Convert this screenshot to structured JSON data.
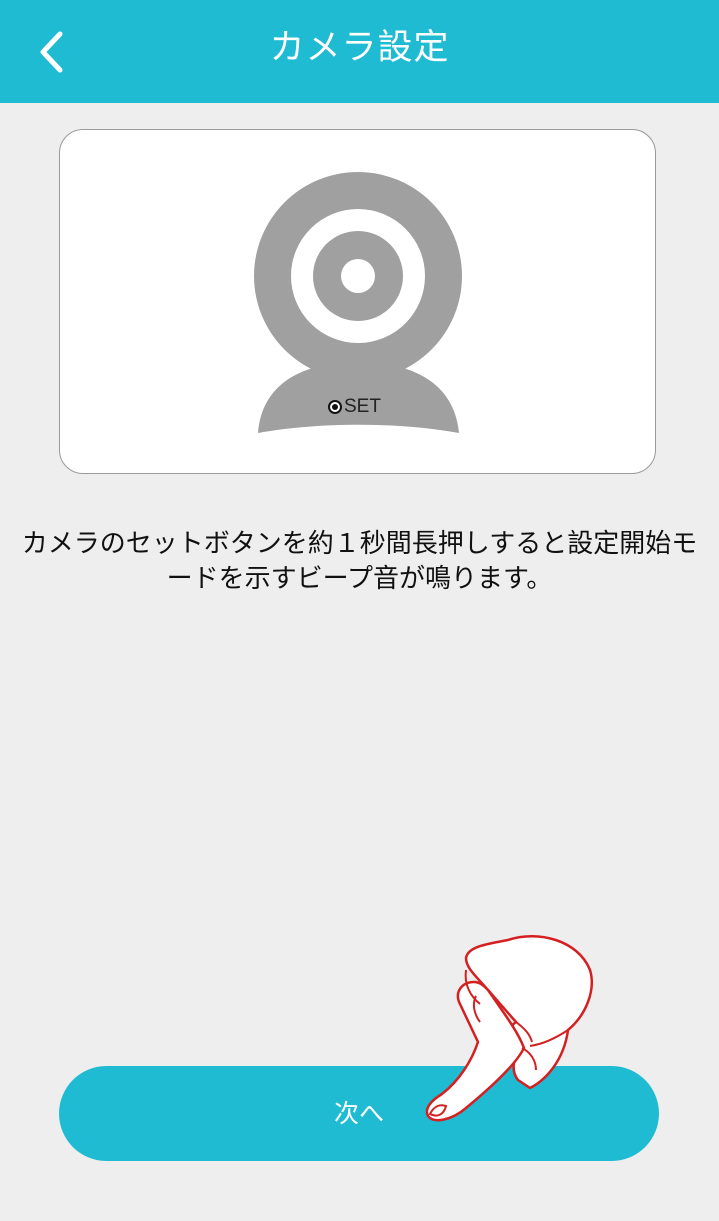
{
  "header": {
    "title": "カメラ設定",
    "back_icon": "chevron-left-icon"
  },
  "camera_card": {
    "icon": "camera-icon",
    "set_label": "SET"
  },
  "instruction": "カメラのセットボタンを約１秒間長押しすると設定開始モードを示すビープ音が鳴ります。",
  "next_button": {
    "label": "次へ"
  },
  "hand_icon": "pointing-hand-icon",
  "colors": {
    "accent": "#1fbbd3",
    "background": "#eeeeee",
    "camera_gray": "#a0a0a0",
    "hand_outline": "#d42020"
  }
}
